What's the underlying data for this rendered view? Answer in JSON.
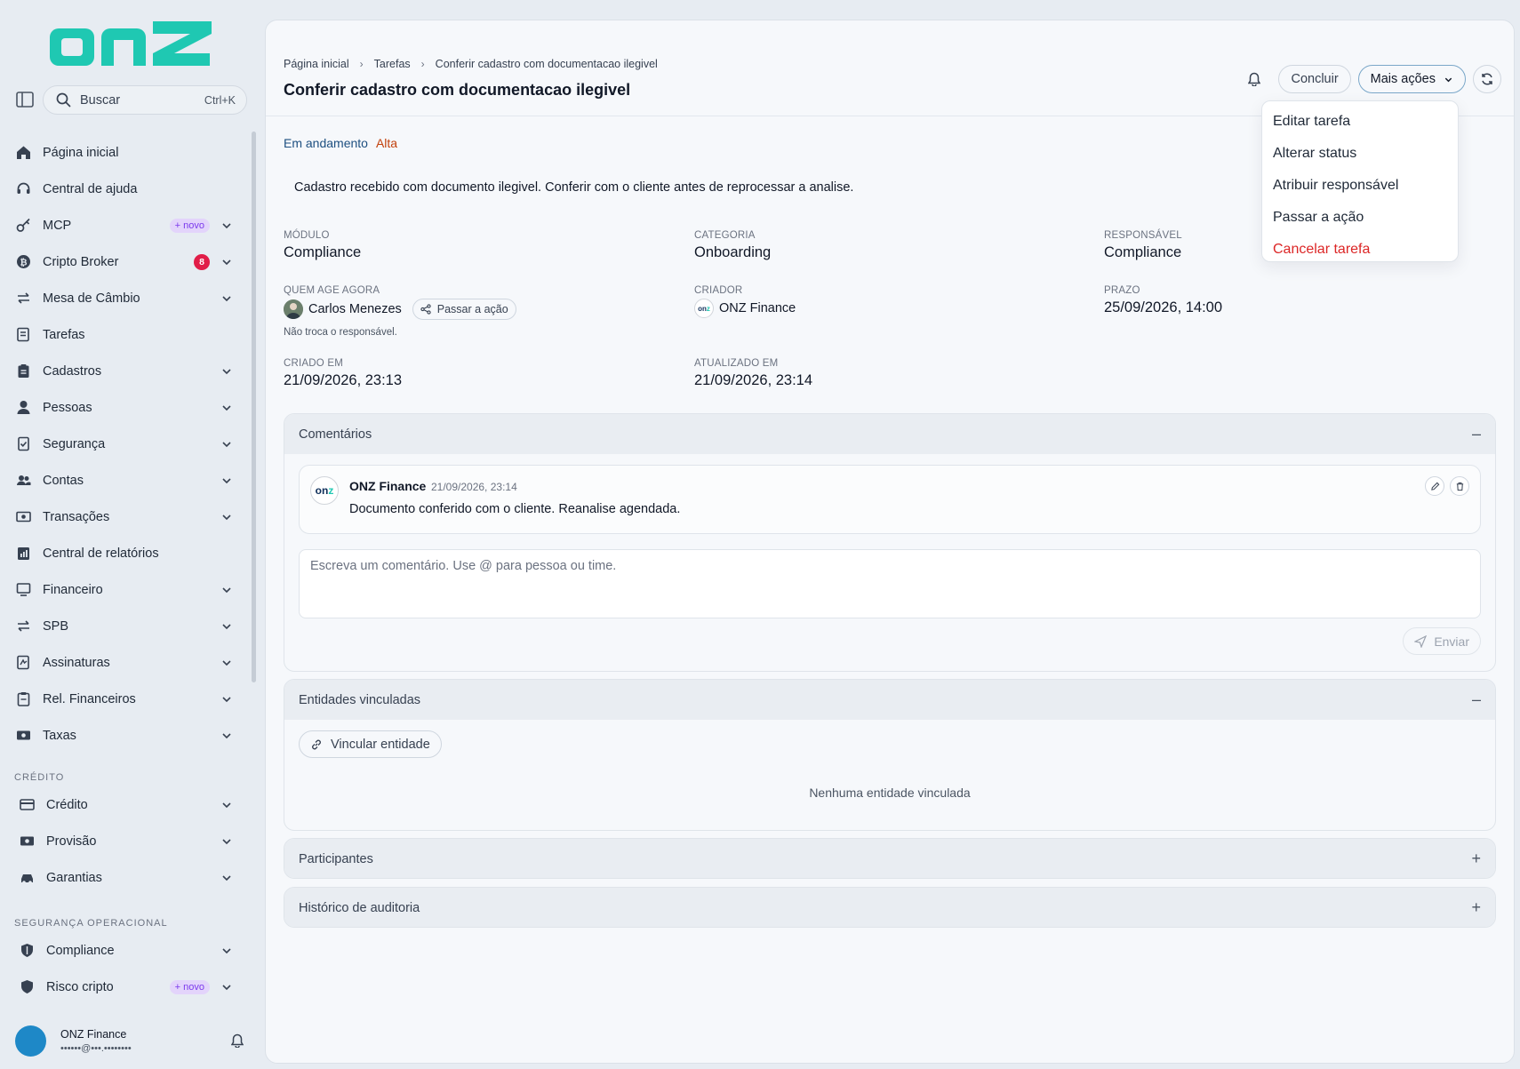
{
  "brand": {
    "logo_text": "onz",
    "logo_color": "#1fc8b2"
  },
  "sidebar": {
    "search": {
      "label": "Buscar",
      "shortcut": "Ctrl+K"
    },
    "items": [
      {
        "label": "Página inicial",
        "icon": "home-icon"
      },
      {
        "label": "Central de ajuda",
        "icon": "headset-icon"
      },
      {
        "label": "MCP",
        "icon": "key-icon",
        "badge": "+ novo"
      },
      {
        "label": "Cripto Broker",
        "icon": "bitcoin-icon",
        "count": "8"
      },
      {
        "label": "Mesa de Câmbio",
        "icon": "swap-icon"
      },
      {
        "label": "Tarefas",
        "icon": "task-icon"
      },
      {
        "label": "Cadastros",
        "icon": "clipboard-icon"
      },
      {
        "label": "Pessoas",
        "icon": "person-icon"
      },
      {
        "label": "Segurança",
        "icon": "shield-check-icon"
      },
      {
        "label": "Contas",
        "icon": "users-icon"
      },
      {
        "label": "Transações",
        "icon": "money-icon"
      },
      {
        "label": "Central de relatórios",
        "icon": "report-icon"
      },
      {
        "label": "Financeiro",
        "icon": "monitor-icon"
      },
      {
        "label": "SPB",
        "icon": "swap-icon"
      },
      {
        "label": "Assinaturas",
        "icon": "signature-icon"
      },
      {
        "label": "Rel. Financeiros",
        "icon": "clipboard-icon"
      },
      {
        "label": "Taxas",
        "icon": "money-icon"
      }
    ],
    "sections": {
      "credito": {
        "title": "CRÉDITO",
        "items": [
          {
            "label": "Crédito",
            "icon": "card-icon"
          },
          {
            "label": "Provisão",
            "icon": "money-icon"
          },
          {
            "label": "Garantias",
            "icon": "car-icon"
          }
        ]
      },
      "seguranca": {
        "title": "SEGURANÇA OPERACIONAL",
        "items": [
          {
            "label": "Compliance",
            "icon": "shield-icon"
          },
          {
            "label": "Risco cripto",
            "icon": "shield-icon",
            "badge": "+ novo"
          }
        ]
      }
    },
    "user": {
      "name": "ONZ Finance",
      "email": "••••••@•••.••••••••"
    }
  },
  "header": {
    "breadcrumb": [
      "Página inicial",
      "Tarefas",
      "Conferir cadastro com documentacao ilegivel"
    ],
    "title": "Conferir cadastro com documentacao ilegivel",
    "actions": {
      "conclude": "Concluir",
      "more": "Mais ações"
    }
  },
  "dropdown": {
    "items": [
      "Editar tarefa",
      "Alterar status",
      "Atribuir responsável",
      "Passar a ação",
      "Cancelar tarefa"
    ]
  },
  "task": {
    "status": "Em andamento",
    "priority": "Alta",
    "description": "Cadastro recebido com documento ilegivel. Conferir com o cliente antes de reprocessar a analise.",
    "fields": {
      "modulo": {
        "label": "MÓDULO",
        "value": "Compliance"
      },
      "categoria": {
        "label": "CATEGORIA",
        "value": "Onboarding"
      },
      "responsavel": {
        "label": "RESPONSÁVEL",
        "value": "Compliance"
      },
      "quem_age": {
        "label": "QUEM AGE AGORA",
        "value": "Carlos Menezes",
        "button": "Passar a ação",
        "hint": "Não troca o responsável."
      },
      "criador": {
        "label": "CRIADOR",
        "value": "ONZ Finance"
      },
      "prazo": {
        "label": "PRAZO",
        "value": "25/09/2026, 14:00"
      },
      "criado_em": {
        "label": "CRIADO EM",
        "value": "21/09/2026, 23:13"
      },
      "atualizado_em": {
        "label": "ATUALIZADO EM",
        "value": "21/09/2026, 23:14"
      }
    }
  },
  "comments": {
    "title": "Comentários",
    "items": [
      {
        "author": "ONZ Finance",
        "time": "21/09/2026, 23:14",
        "text": "Documento conferido com o cliente. Reanalise agendada."
      }
    ],
    "input_placeholder": "Escreva um comentário. Use @ para pessoa ou time.",
    "send": "Enviar"
  },
  "entities": {
    "title": "Entidades vinculadas",
    "link_button": "Vincular entidade",
    "empty": "Nenhuma entidade vinculada"
  },
  "participants": {
    "title": "Participantes"
  },
  "audit": {
    "title": "Histórico de auditoria"
  }
}
